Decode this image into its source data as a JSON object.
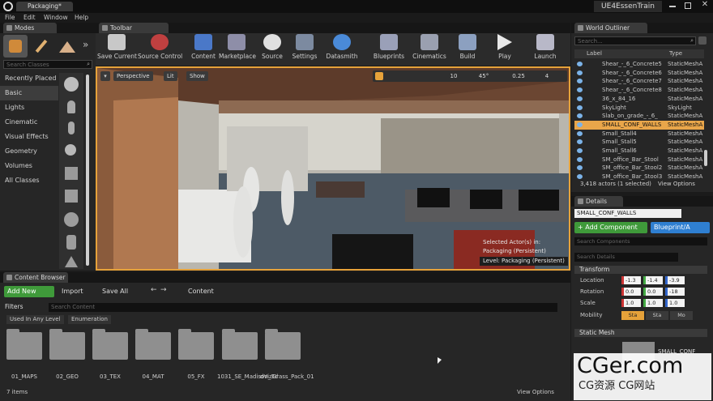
{
  "window": {
    "tab_title": "Packaging*",
    "project_name": "UE4EssenTrain"
  },
  "menu": [
    "File",
    "Edit",
    "Window",
    "Help"
  ],
  "panels": {
    "modes_tab": "Modes",
    "toolbar_tab": "Toolbar",
    "outliner_tab": "World Outliner",
    "content_tab": "Content Browser",
    "details_tab": "Details"
  },
  "modes": {
    "search_placeholder": "Search Classes",
    "categories": [
      "Recently Placed",
      "Basic",
      "Lights",
      "Cinematic",
      "Visual Effects",
      "Geometry",
      "Volumes",
      "All Classes"
    ],
    "selected_category": "Basic"
  },
  "toolbar": {
    "buttons": [
      "Save Current",
      "Source Control",
      "Content",
      "Marketplace",
      "Source",
      "Settings",
      "Datasmith",
      "Blueprints",
      "Cinematics",
      "Build",
      "Play",
      "Launch"
    ]
  },
  "viewport": {
    "perspective_label": "Perspective",
    "lit_label": "Lit",
    "show_label": "Show",
    "grid_snap": "10",
    "rot_snap": "45°",
    "scale_snap": "0.25",
    "cam_speed": "4",
    "selected_actor_text": "Selected Actor(s) in:",
    "selected_actor_level": "Packaging (Persistent)",
    "level_label": "Level:  Packaging (Persistent)"
  },
  "outliner": {
    "search_placeholder": "Search...",
    "col_label": "Label",
    "col_type": "Type",
    "rows": [
      {
        "label": "Shear_-_6_Concrete5",
        "type": "StaticMeshA"
      },
      {
        "label": "Shear_-_6_Concrete6",
        "type": "StaticMeshA"
      },
      {
        "label": "Shear_-_6_Concrete7",
        "type": "StaticMeshA"
      },
      {
        "label": "Shear_-_6_Concrete8",
        "type": "StaticMeshA"
      },
      {
        "label": "36_x_84_16",
        "type": "StaticMeshA"
      },
      {
        "label": "SkyLight",
        "type": "SkyLight"
      },
      {
        "label": "Slab_on_grade_-_6_",
        "type": "StaticMeshA"
      },
      {
        "label": "SMALL_CONF_WALLS",
        "type": "StaticMeshA"
      },
      {
        "label": "Small_Stall4",
        "type": "StaticMeshA"
      },
      {
        "label": "Small_Stall5",
        "type": "StaticMeshA"
      },
      {
        "label": "Small_Stall6",
        "type": "StaticMeshA"
      },
      {
        "label": "SM_office_Bar_Stool",
        "type": "StaticMeshA"
      },
      {
        "label": "SM_office_Bar_Stool2",
        "type": "StaticMeshA"
      },
      {
        "label": "SM_office_Bar_Stool3",
        "type": "StaticMeshA"
      }
    ],
    "selected_index": 7,
    "status": "3,418 actors (1 selected)",
    "view_options": "View Options"
  },
  "details": {
    "name_value": "SMALL_CONF_WALLS",
    "add_component": "+ Add Component",
    "blueprint": "Blueprint/A",
    "search_components": "Search Components",
    "search_details": "Search Details",
    "transform_header": "Transform",
    "location_label": "Location",
    "rotation_label": "Rotation",
    "scale_label": "Scale",
    "mobility_label": "Mobility",
    "location": [
      "-1.3",
      "-1.4",
      "-3.9"
    ],
    "rotation": [
      "0.0",
      "0.0",
      "-18"
    ],
    "scale": [
      "1.0",
      "1.0",
      "1.0"
    ],
    "mobility": [
      "Sta",
      "Sta",
      "Mo"
    ],
    "static_mesh_header": "Static Mesh",
    "static_mesh_value": "SMALL_CONF"
  },
  "content_browser": {
    "add_new": "Add New",
    "import": "Import",
    "save_all": "Save All",
    "path": "Content",
    "filters": "Filters",
    "search_placeholder": "Search Content",
    "filter_chips": [
      "Used In Any Level",
      "Enumeration"
    ],
    "folders": [
      "01_MAPS",
      "02_GEO",
      "03_TEX",
      "04_MAT",
      "05_FX",
      "1031_SE_Madison_3d",
      "dVizGrass_Pack_01"
    ],
    "item_count": "7 items",
    "view_options": "View Options"
  },
  "watermark": {
    "line1": "CGer.com",
    "line2": "CG资源 CG网站"
  },
  "colors": {
    "accent_blue": "#2f7fd1",
    "add_green": "#3f9a3a",
    "selected_orange": "#e6a23a",
    "outliner_selected": "#e9a64a"
  }
}
